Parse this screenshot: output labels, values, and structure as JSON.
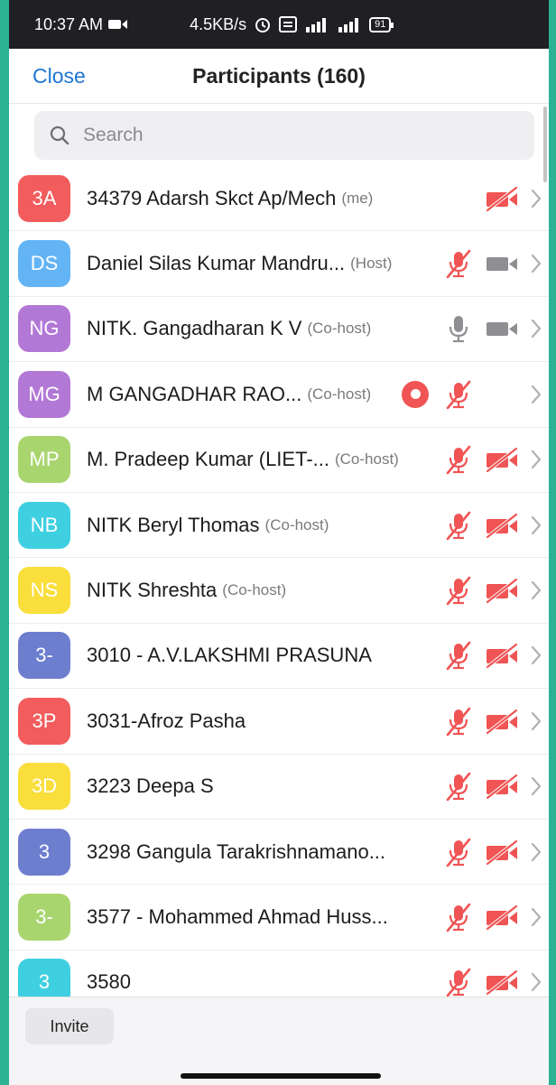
{
  "status_bar": {
    "time": "10:37 AM",
    "net_speed": "4.5KB/s",
    "battery": "91"
  },
  "header": {
    "close_label": "Close",
    "title": "Participants (160)"
  },
  "search": {
    "placeholder": "Search"
  },
  "colors": {
    "accent": "#1f76d2",
    "muted_red": "#f05454",
    "icon_grey": "#8e8e93"
  },
  "participants": [
    {
      "initials": "3A",
      "color": "#f25c5c",
      "name": "34379 Adarsh Skct Ap/Mech",
      "role": "(me)",
      "rec": false,
      "mic": "none",
      "video": "muted"
    },
    {
      "initials": "DS",
      "color": "#63b4f5",
      "name": "Daniel Silas Kumar Mandru...",
      "role": "(Host)",
      "rec": false,
      "mic": "muted",
      "video": "on"
    },
    {
      "initials": "NG",
      "color": "#b278d6",
      "name": "NITK. Gangadharan K V",
      "role": "(Co-host)",
      "rec": false,
      "mic": "on",
      "video": "on"
    },
    {
      "initials": "MG",
      "color": "#b278d6",
      "name": "M GANGADHAR RAO...",
      "role": "(Co-host)",
      "rec": true,
      "mic": "muted",
      "video": "none"
    },
    {
      "initials": "MP",
      "color": "#a9d56f",
      "name": "M. Pradeep Kumar (LIET-...",
      "role": "(Co-host)",
      "rec": false,
      "mic": "muted",
      "video": "muted"
    },
    {
      "initials": "NB",
      "color": "#3ed0e0",
      "name": "NITK Beryl Thomas",
      "role": "(Co-host)",
      "rec": false,
      "mic": "muted",
      "video": "muted"
    },
    {
      "initials": "NS",
      "color": "#f9de3c",
      "name": "NITK Shreshta",
      "role": "(Co-host)",
      "rec": false,
      "mic": "muted",
      "video": "muted"
    },
    {
      "initials": "3-",
      "color": "#6d7ecf",
      "name": "3010 - A.V.LAKSHMI PRASUNA",
      "role": "",
      "rec": false,
      "mic": "muted",
      "video": "muted"
    },
    {
      "initials": "3P",
      "color": "#f25c5c",
      "name": "3031-Afroz Pasha",
      "role": "",
      "rec": false,
      "mic": "muted",
      "video": "muted"
    },
    {
      "initials": "3D",
      "color": "#f9de3c",
      "name": "3223 Deepa S",
      "role": "",
      "rec": false,
      "mic": "muted",
      "video": "muted"
    },
    {
      "initials": "3",
      "color": "#6d7ecf",
      "name": "3298  Gangula Tarakrishnamano...",
      "role": "",
      "rec": false,
      "mic": "muted",
      "video": "muted"
    },
    {
      "initials": "3-",
      "color": "#a9d56f",
      "name": "3577 - Mohammed Ahmad Huss...",
      "role": "",
      "rec": false,
      "mic": "muted",
      "video": "muted"
    },
    {
      "initials": "3",
      "color": "#3ed0e0",
      "name": "3580",
      "role": "",
      "rec": false,
      "mic": "muted",
      "video": "muted"
    }
  ],
  "footer": {
    "invite_label": "Invite"
  }
}
